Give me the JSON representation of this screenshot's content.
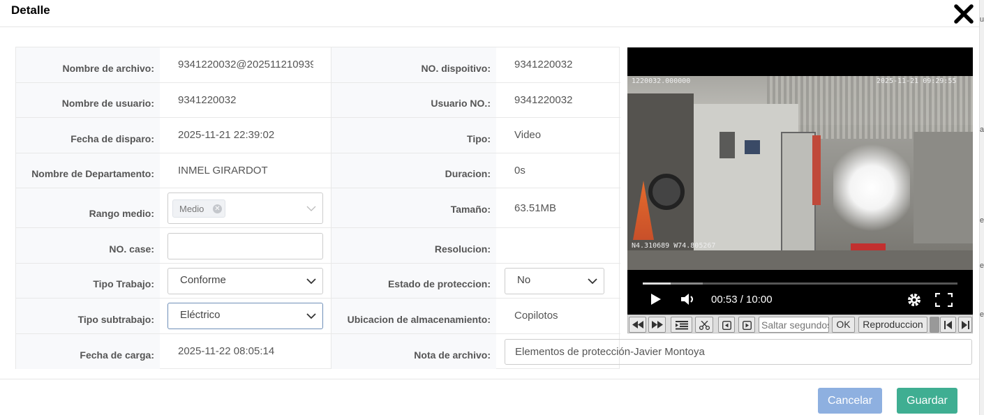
{
  "dialog": {
    "title": "Detalle"
  },
  "fields": {
    "nombre_archivo": {
      "label": "Nombre de archivo:",
      "value": "9341220032@202511210939"
    },
    "no_dispositivo": {
      "label": "NO. dispoitivo:",
      "value": "9341220032"
    },
    "nombre_usuario": {
      "label": "Nombre de usuario:",
      "value": "9341220032"
    },
    "usuario_no": {
      "label": "Usuario NO.:",
      "value": "9341220032"
    },
    "fecha_disparo": {
      "label": "Fecha de disparo:",
      "value": "2025-11-21 22:39:02"
    },
    "tipo": {
      "label": "Tipo:",
      "value": "Video"
    },
    "nombre_departamento": {
      "label": "Nombre de Departamento:",
      "value": "INMEL GIRARDOT"
    },
    "duracion": {
      "label": "Duracion:",
      "value": "0s"
    },
    "rango_medio": {
      "label": "Rango medio:",
      "tag": "Medio"
    },
    "tamano": {
      "label": "Tamaño:",
      "value": "63.51MB"
    },
    "no_case": {
      "label": "NO. case:",
      "value": ""
    },
    "resolucion": {
      "label": "Resolucion:",
      "value": ""
    },
    "tipo_trabajo": {
      "label": "Tipo Trabajo:",
      "selected": "Conforme"
    },
    "estado_proteccion": {
      "label": "Estado de proteccion:",
      "selected": "No"
    },
    "tipo_subtrabajo": {
      "label": "Tipo subtrabajo:",
      "selected": "Eléctrico"
    },
    "ubicacion": {
      "label": "Ubicacion de almacenamiento:",
      "value": "Copilotos"
    },
    "fecha_carga": {
      "label": "Fecha de carga:",
      "value": "2025-11-22 08:05:14"
    },
    "nota_archivo": {
      "label": "Nota de archivo:",
      "value": "Elementos de protección-Javier Montoya"
    }
  },
  "video": {
    "overlay_id": "1220032.000000",
    "overlay_datetime": "2025-11-21  09:29:55",
    "overlay_gps": "N4.310689  W74.805267",
    "time_display": "00:53 / 10:00",
    "progress": 0.088,
    "buffered": 0.19
  },
  "toolbar": {
    "saltar_placeholder": "Saltar segundos",
    "ok_label": "OK",
    "reproduccion_label": "Reproduccion"
  },
  "footer": {
    "cancel_label": "Cancelar",
    "save_label": "Guardar"
  },
  "colors": {
    "cancel": "#8eb0e0",
    "save": "#3fae92"
  }
}
